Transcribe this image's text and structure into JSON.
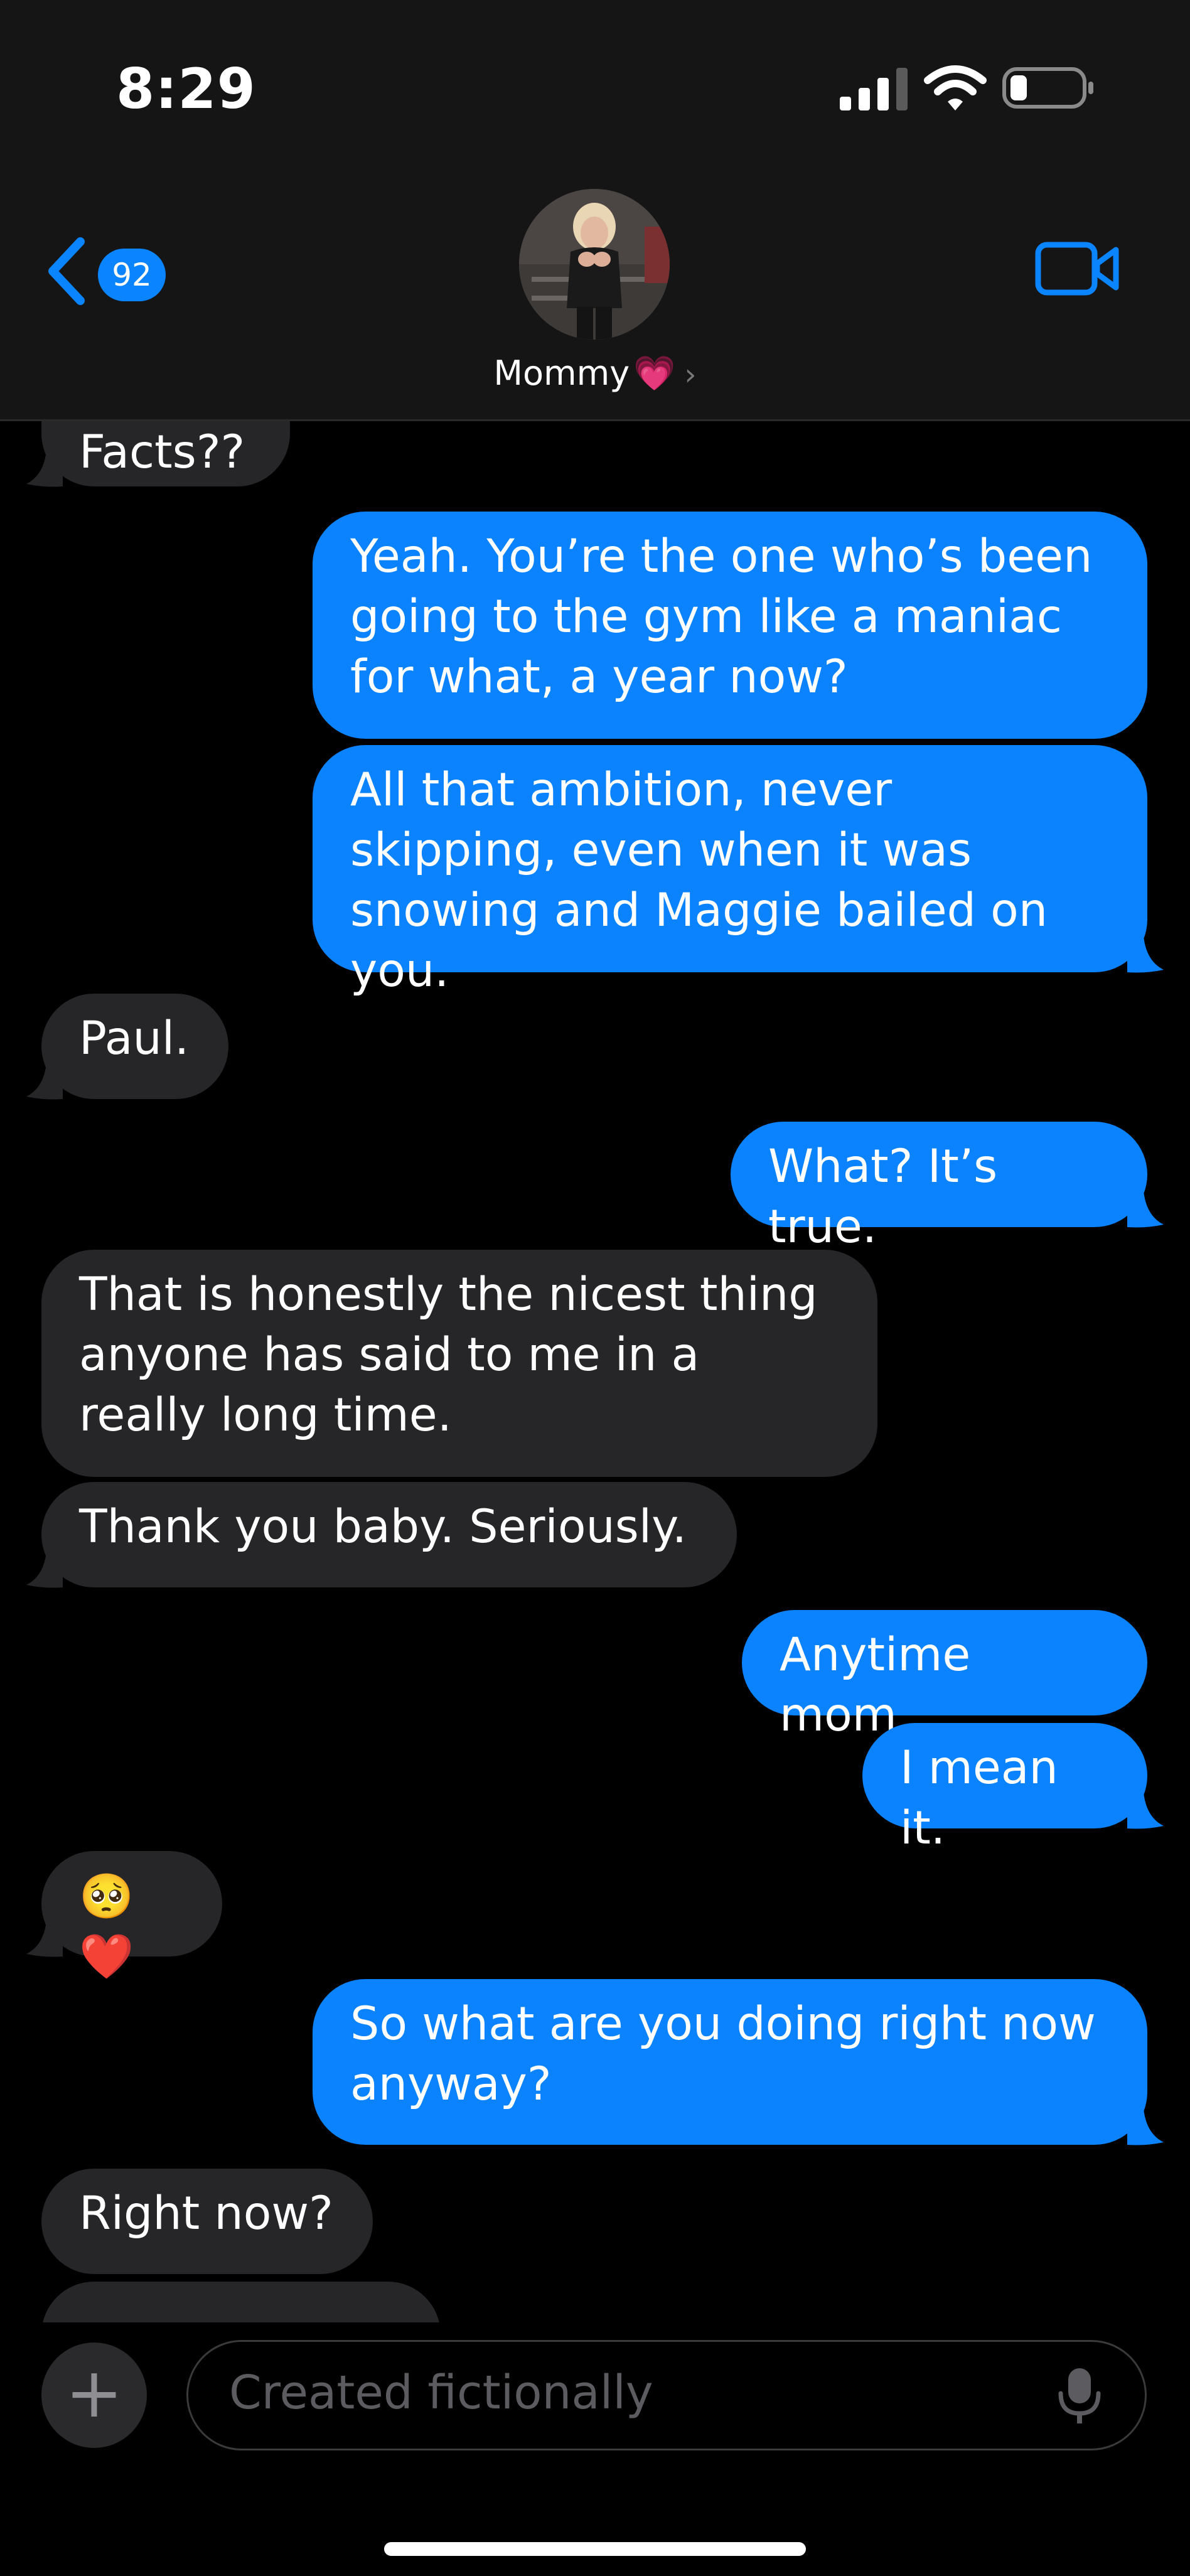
{
  "status_bar": {
    "time": "8:29"
  },
  "header": {
    "back_count": "92",
    "contact_name": "Mommy",
    "contact_heart": "💗",
    "contact_chevron": "›"
  },
  "messages": [
    {
      "side": "received",
      "text": "Facts??"
    },
    {
      "side": "sent",
      "text": "Yeah. You’re the one who’s been going to the gym like a maniac for what, a year now?"
    },
    {
      "side": "sent",
      "text": "All that ambition, never skipping, even when it was snowing and Maggie bailed on you."
    },
    {
      "side": "received",
      "text": "Paul."
    },
    {
      "side": "sent",
      "text": "What? It’s true."
    },
    {
      "side": "received",
      "text": "That is honestly the nicest thing anyone has said to me in a really long time."
    },
    {
      "side": "received",
      "text": "Thank you baby. Seriously."
    },
    {
      "side": "sent",
      "text": "Anytime mom."
    },
    {
      "side": "sent",
      "text": "I mean it."
    },
    {
      "side": "received",
      "text": "🥺❤️"
    },
    {
      "side": "sent",
      "text": "So what are you doing right now anyway?"
    },
    {
      "side": "received",
      "text": "Right now?"
    }
  ],
  "composer": {
    "plus": "+",
    "placeholder": "Created fictionally"
  },
  "colors": {
    "sent_bubble": "#0b83fe",
    "received_bubble": "#262628",
    "accent": "#0a84ff",
    "background": "#000000"
  },
  "icons": [
    "signal-icon",
    "wifi-icon",
    "battery-icon",
    "back-chevron-icon",
    "video-call-icon",
    "plus-icon",
    "microphone-icon"
  ]
}
